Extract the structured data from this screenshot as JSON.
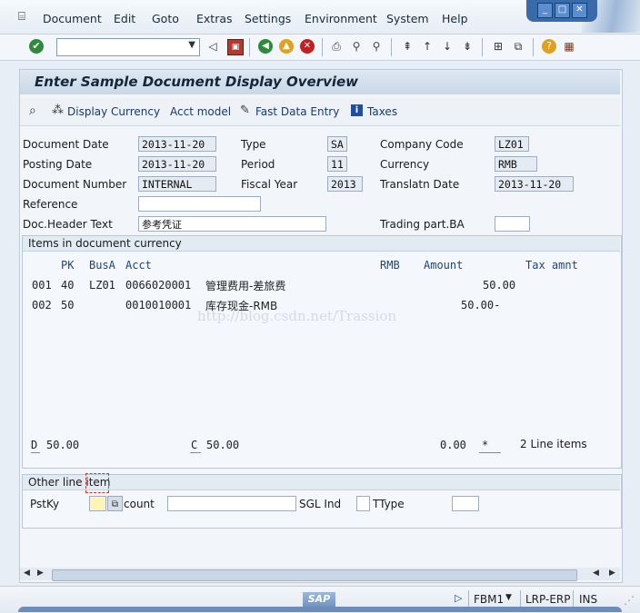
{
  "menu": {
    "items": [
      "Document",
      "Edit",
      "Goto",
      "Extras",
      "Settings",
      "Environment",
      "System",
      "Help"
    ]
  },
  "window_controls": {
    "minimize": "_",
    "maximize": "□",
    "close": "✕"
  },
  "toolbar": {
    "command_field_value": ""
  },
  "screen": {
    "title": "Enter Sample Document Display Overview"
  },
  "app_toolbar": {
    "display_currency": "Display Currency",
    "acct_model": "Acct model",
    "fast_data_entry": "Fast Data Entry",
    "taxes": "Taxes"
  },
  "header": {
    "document_date": {
      "label": "Document Date",
      "value": "2013-11-20"
    },
    "posting_date": {
      "label": "Posting Date",
      "value": "2013-11-20"
    },
    "document_number": {
      "label": "Document Number",
      "value": "INTERNAL"
    },
    "reference": {
      "label": "Reference",
      "value": ""
    },
    "doc_header_text": {
      "label": "Doc.Header Text",
      "value": "参考凭证"
    },
    "type": {
      "label": "Type",
      "value": "SA"
    },
    "period": {
      "label": "Period",
      "value": "11"
    },
    "fiscal_year": {
      "label": "Fiscal Year",
      "value": "2013"
    },
    "company_code": {
      "label": "Company Code",
      "value": "LZ01"
    },
    "currency": {
      "label": "Currency",
      "value": "RMB"
    },
    "translatn_date": {
      "label": "Translatn Date",
      "value": "2013-11-20"
    },
    "trading_part": {
      "label": "Trading part.BA",
      "value": ""
    }
  },
  "items": {
    "title": "Items in document currency",
    "columns": {
      "pk": "PK",
      "busa": "BusA",
      "acct": "Acct",
      "currency": "RMB",
      "amount": "Amount",
      "tax_amnt": "Tax amnt"
    },
    "rows": [
      {
        "line": "001",
        "pk": "40",
        "busa": "LZ01",
        "acct": "0066020001",
        "desc": "管理费用-差旅费",
        "amount": "50.00"
      },
      {
        "line": "002",
        "pk": "50",
        "busa": "",
        "acct": "0010010001",
        "desc": "库存现金-RMB",
        "amount": "50.00-"
      }
    ],
    "watermark": "http://blog.csdn.net/Trassion",
    "footer": {
      "debit_label": "D",
      "debit_value": "50.00",
      "credit_label": "C",
      "credit_value": "50.00",
      "balance": "0.00",
      "balance_flag": "*",
      "line_items": "2 Line items"
    }
  },
  "other_line": {
    "title": "Other line item",
    "pstky_label": "PstKy",
    "pstky_value": "",
    "account_label": "count",
    "account_value": "",
    "sgl_label": "SGL Ind",
    "sgl_value": "",
    "ttype_label": "TType",
    "ttype_value": ""
  },
  "status": {
    "logo": "SAP",
    "transaction": "FBM1",
    "system": "LRP-ERP",
    "mode": "INS"
  }
}
